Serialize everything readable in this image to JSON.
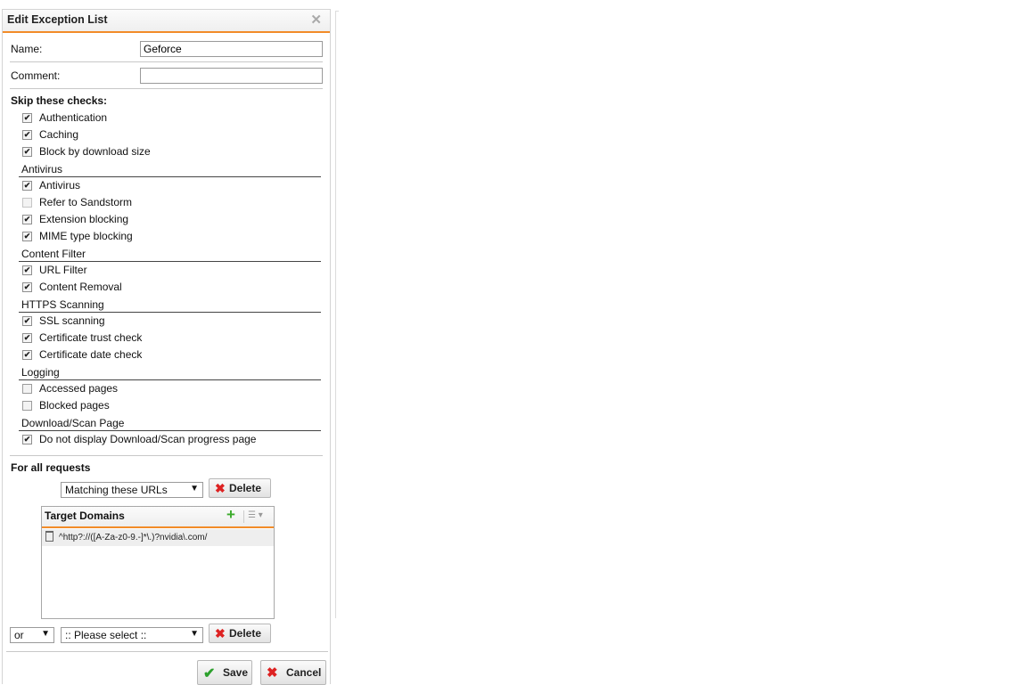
{
  "dialog": {
    "title": "Edit Exception List"
  },
  "form": {
    "name_label": "Name:",
    "name_value": "Geforce",
    "comment_label": "Comment:",
    "comment_value": ""
  },
  "skip": {
    "title": "Skip these checks:",
    "top_items": [
      {
        "label": "Authentication",
        "checked": true
      },
      {
        "label": "Caching",
        "checked": true
      },
      {
        "label": "Block by download size",
        "checked": true
      }
    ],
    "groups": [
      {
        "title": "Antivirus",
        "items": [
          {
            "label": "Antivirus",
            "checked": true
          },
          {
            "label": "Refer to Sandstorm",
            "checked": false,
            "disabled": true
          },
          {
            "label": "Extension blocking",
            "checked": true
          },
          {
            "label": "MIME type blocking",
            "checked": true
          }
        ]
      },
      {
        "title": "Content Filter",
        "items": [
          {
            "label": "URL Filter",
            "checked": true
          },
          {
            "label": "Content Removal",
            "checked": true
          }
        ]
      },
      {
        "title": "HTTPS Scanning",
        "items": [
          {
            "label": "SSL scanning",
            "checked": true
          },
          {
            "label": "Certificate trust check",
            "checked": true
          },
          {
            "label": "Certificate date check",
            "checked": true
          }
        ]
      },
      {
        "title": "Logging",
        "items": [
          {
            "label": "Accessed pages",
            "checked": false
          },
          {
            "label": "Blocked pages",
            "checked": false
          }
        ]
      },
      {
        "title": "Download/Scan Page",
        "items": [
          {
            "label": "Do not display Download/Scan progress page",
            "checked": true
          }
        ]
      }
    ]
  },
  "requests": {
    "title": "For all requests",
    "condition1": "Matching these URLs",
    "delete_label": "Delete",
    "domains_title": "Target Domains",
    "domains": [
      "^http?://([A-Za-z0-9.-]*\\.)?nvidia\\.com/"
    ],
    "connector": "or",
    "condition2": ":: Please select ::"
  },
  "footer": {
    "save_label": "Save",
    "cancel_label": "Cancel"
  },
  "colors": {
    "accent": "#f28c28",
    "add": "#3bab2b",
    "delete": "#d22222"
  },
  "icons": [
    "close-icon",
    "check-icon",
    "delete-x-icon",
    "add-plus-icon",
    "list-menu-icon",
    "trash-icon",
    "dropdown-arrow-icon"
  ]
}
